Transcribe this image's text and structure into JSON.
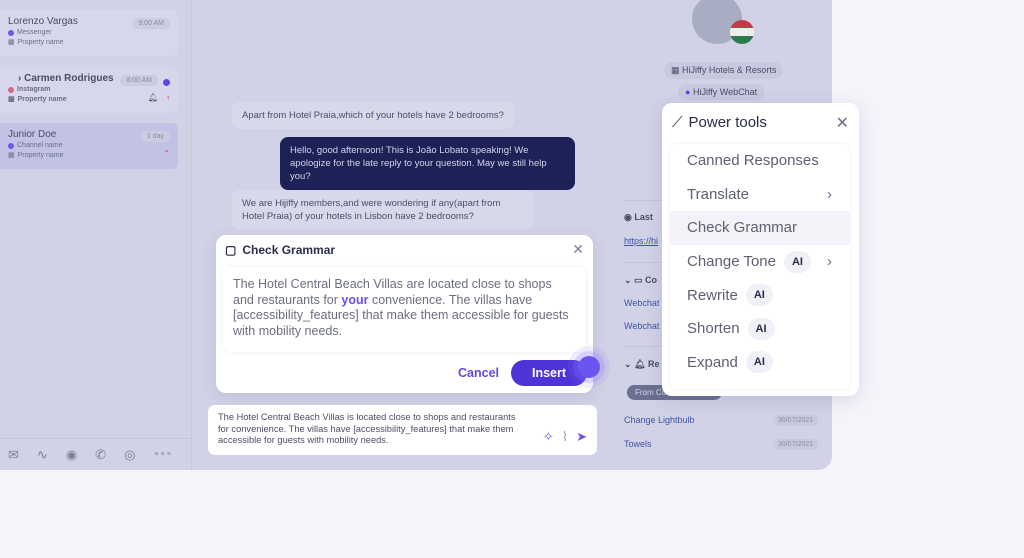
{
  "conversations": [
    {
      "name": "Lorenzo Vargas",
      "channel": "Messenger",
      "property": "Property name",
      "time": "9:00 AM"
    },
    {
      "name": "Carmen Rodrigues",
      "channel": "Instagram",
      "property": "Property name",
      "time": "8:00 AM"
    },
    {
      "name": "Junior Doe",
      "channel": "Channel name",
      "property": "Property name",
      "time": "1 day"
    }
  ],
  "channel_icons": [
    "mail-icon",
    "webchat-icon",
    "messenger-icon",
    "whatsapp-icon",
    "instagram-icon",
    "more-icon"
  ],
  "channel_glyphs": [
    "✉",
    "∿",
    "◉",
    "✆",
    "◎",
    "∘∘∘"
  ],
  "messages": [
    {
      "text": "Apart from Hotel Praia,which of your hotels have 2 bedrooms?"
    },
    {
      "text": "Hello, good afternoon! This is João Lobato speaking! We apologize for the late reply to your question. May we still help you?"
    },
    {
      "text": "We are Hijiffy members,and were wondering if any(apart from Hotel Praia) of your hotels in Lisbon have 2 bedrooms?"
    }
  ],
  "contact": {
    "property": "HiJiffy Hotels & Resorts",
    "channel": "HiJiffy WebChat"
  },
  "sidebar": {
    "last": "Last",
    "link": "https://hi",
    "conv_heading": "Co",
    "conv_links": [
      "Webchat",
      "Webchat"
    ],
    "req_heading": "Re",
    "req_chip": "From Co",
    "requests": [
      {
        "name": "Change Lightbulb",
        "date": "30/07/2021"
      },
      {
        "name": "Towels",
        "date": "30/07/2021"
      }
    ]
  },
  "grammar": {
    "title": "Check Grammar",
    "text_before": "The Hotel Central Beach Villas are located close to shops and restaurants for ",
    "highlight": "your",
    "text_after": " convenience. The villas have [accessibility_features] that make them accessible for guests with mobility needs.",
    "cancel": "Cancel",
    "insert": "Insert"
  },
  "compose": {
    "value": "The Hotel Central Beach Villas is located close to shops and restaurants for convenience. The villas have [accessibility_features] that make them accessible for guests with mobility needs."
  },
  "power_tools": {
    "title": "Power tools",
    "ai_label": "AI",
    "items": [
      {
        "label": "Canned Responses"
      },
      {
        "label": "Translate"
      },
      {
        "label": "Check Grammar"
      },
      {
        "label": "Change Tone"
      },
      {
        "label": "Rewrite"
      },
      {
        "label": "Shorten"
      },
      {
        "label": "Expand"
      }
    ]
  },
  "colors": {
    "accent": "#4f33d6",
    "highlight": "#6a4ff0",
    "outgoing_bubble": "#1d2156",
    "overlay": "#d1d2e6"
  }
}
